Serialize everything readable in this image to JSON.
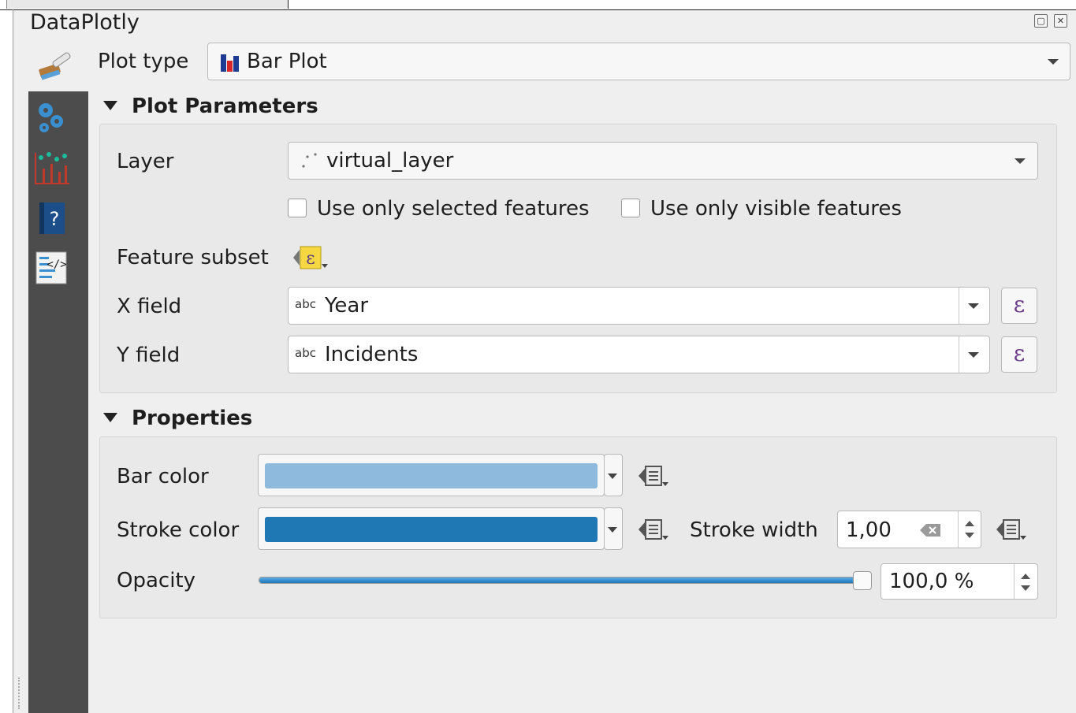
{
  "panel": {
    "title": "DataPlotly",
    "float_glyph": "▢",
    "close_glyph": "✕"
  },
  "plot_type": {
    "label": "Plot type",
    "value": "Bar Plot"
  },
  "sidebar": {
    "items": [
      {
        "icon": "gears-icon"
      },
      {
        "icon": "scatter-bar-icon"
      },
      {
        "icon": "help-book-icon"
      },
      {
        "icon": "code-icon"
      }
    ]
  },
  "plot_parameters": {
    "heading": "Plot Parameters",
    "layer_label": "Layer",
    "layer_value": "virtual_layer",
    "selected_features_label": "Use only selected features",
    "visible_features_label": "Use only visible features",
    "feature_subset_label": "Feature subset",
    "x_field_label": "X field",
    "x_field_type": "abc",
    "x_field_value": "Year",
    "y_field_label": "Y field",
    "y_field_type": "abc",
    "y_field_value": "Incidents",
    "expression_glyph": "ε"
  },
  "properties": {
    "heading": "Properties",
    "bar_color_label": "Bar color",
    "bar_color": "#8dbadd",
    "stroke_color_label": "Stroke color",
    "stroke_color": "#1f77b4",
    "stroke_width_label": "Stroke width",
    "stroke_width_value": "1,00",
    "opacity_label": "Opacity",
    "opacity_value": "100,0 %",
    "opacity_fraction": 1.0
  },
  "colors": {
    "sidebar_bg": "#4c4c4c",
    "accent": "#1f77b4",
    "expression": "#6a3a87"
  }
}
